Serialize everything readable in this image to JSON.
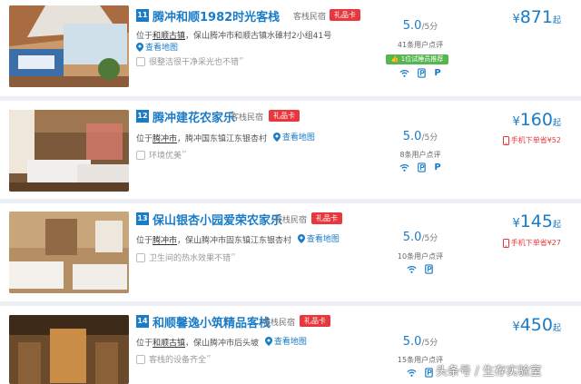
{
  "listings": [
    {
      "index": "11",
      "name": "腾冲和顺1982时光客栈",
      "type": "客栈民宿",
      "gift": "礼品卡",
      "addr_prefix": "位于",
      "addr_link": "和顺古镇",
      "addr_rest": "，保山腾冲市和顺古镇水碓村2小组41号",
      "map_label": "查看地图",
      "quote": "很整洁很干净采光也不错",
      "score": "5.0",
      "score_unit": "/5分",
      "reviews": "41条用户点评",
      "recommend": "1位试睡员推荐",
      "amenities": [
        "wifi-icon",
        "parking-icon",
        "p-label"
      ],
      "currency": "¥",
      "price": "871",
      "price_suffix": "起",
      "mobile": ""
    },
    {
      "index": "12",
      "name": "腾冲建花农家乐",
      "type": "客栈民宿",
      "gift": "礼品卡",
      "addr_prefix": "位于",
      "addr_link": "腾冲市",
      "addr_rest": "，腾冲国东镇江东银杏村",
      "map_label": "查看地图",
      "quote": "环境优美",
      "score": "5.0",
      "score_unit": "/5分",
      "reviews": "8条用户点评",
      "recommend": "",
      "amenities": [
        "wifi-icon",
        "parking-icon",
        "p-label"
      ],
      "currency": "¥",
      "price": "160",
      "price_suffix": "起",
      "mobile": "手机下单省¥52"
    },
    {
      "index": "13",
      "name": "保山银杏小园爱荣农家乐",
      "type": "客栈民宿",
      "gift": "礼品卡",
      "addr_prefix": "位于",
      "addr_link": "腾冲市",
      "addr_rest": "，保山腾冲市固东镇江东银杏村",
      "map_label": "查看地图",
      "quote": "卫生间的热水效果不错",
      "score": "5.0",
      "score_unit": "/5分",
      "reviews": "10条用户点评",
      "recommend": "",
      "amenities": [
        "wifi-icon",
        "parking-icon"
      ],
      "currency": "¥",
      "price": "145",
      "price_suffix": "起",
      "mobile": "手机下单省¥27"
    },
    {
      "index": "14",
      "name": "和顺馨逸小筑精品客栈",
      "type": "客栈民宿",
      "gift": "礼品卡",
      "addr_prefix": "位于",
      "addr_link": "和顺古镇",
      "addr_rest": "，保山腾冲市后头坡",
      "map_label": "查看地图",
      "quote": "客栈的设备齐全",
      "score": "5.0",
      "score_unit": "/5分",
      "reviews": "15条用户点评",
      "recommend": "",
      "amenities": [
        "wifi-icon",
        "parking-icon"
      ],
      "currency": "¥",
      "price": "450",
      "price_suffix": "起",
      "mobile": ""
    }
  ],
  "watermark": "头条号 / 生存实验室",
  "colors": {
    "accent": "#1a7bc7",
    "gift": "#e8383d",
    "recommend": "#56b650"
  }
}
